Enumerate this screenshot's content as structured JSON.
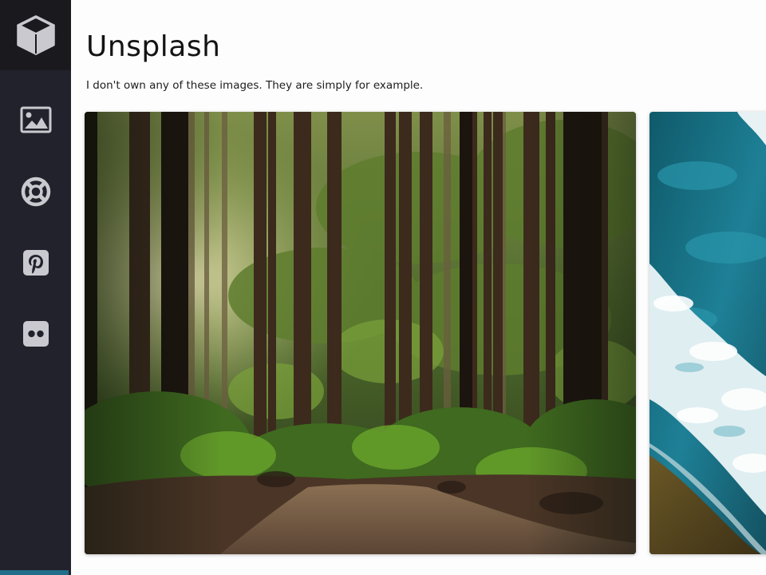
{
  "sidebar": {
    "logo_icon": "cube-icon",
    "items": [
      {
        "icon": "image-icon"
      },
      {
        "icon": "lifebuoy-icon"
      },
      {
        "icon": "pinterest-icon"
      },
      {
        "icon": "flickr-icon"
      }
    ],
    "accent_color": "#1f6f8a"
  },
  "main": {
    "title": "Unsplash",
    "subtitle": "I don't own any of these images. They are simply for example.",
    "gallery": [
      {
        "subject": "forest-path-photo"
      },
      {
        "subject": "ocean-waves-photo"
      }
    ]
  },
  "colors": {
    "sidebar_bg": "#22222c",
    "logo_bg": "#1a191d",
    "icon_color": "#c9c9cf"
  }
}
